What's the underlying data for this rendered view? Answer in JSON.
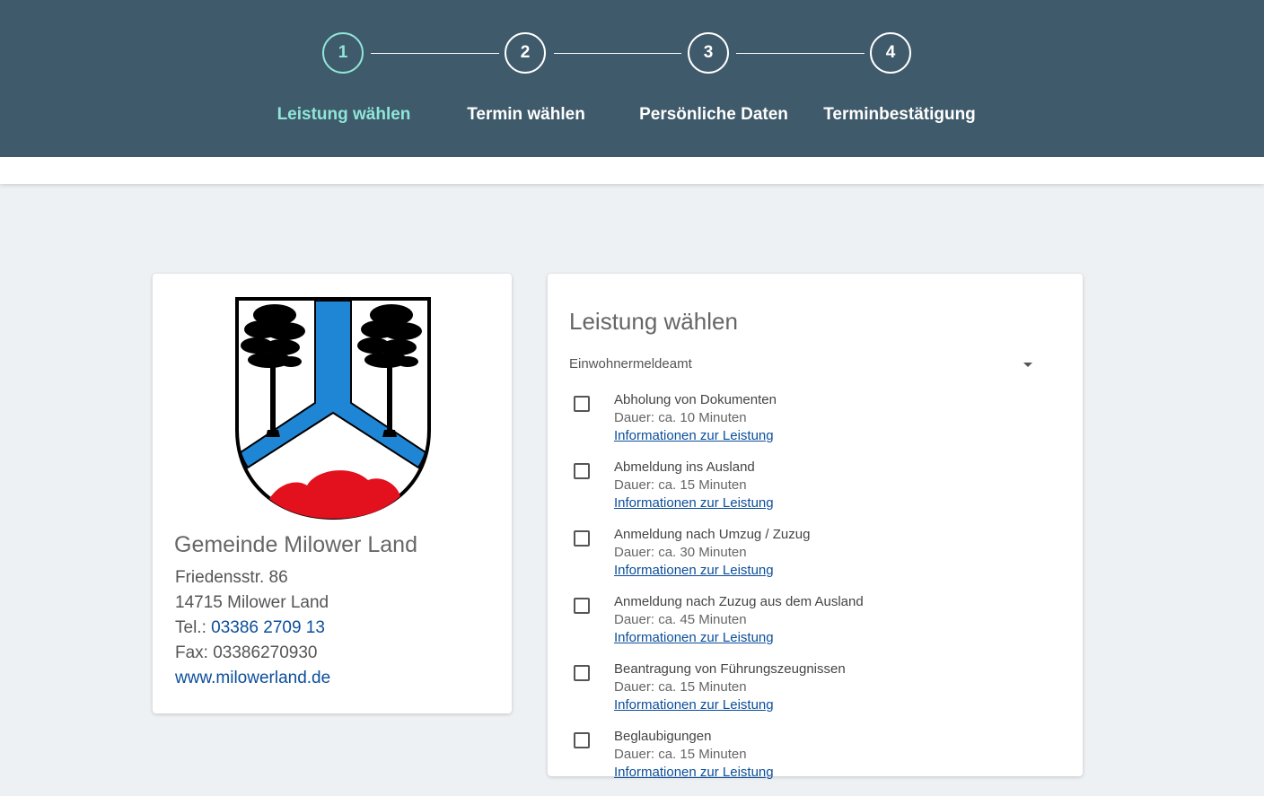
{
  "stepper": {
    "steps": [
      {
        "number": "1",
        "label": "Leistung wählen",
        "active": true
      },
      {
        "number": "2",
        "label": "Termin wählen",
        "active": false
      },
      {
        "number": "3",
        "label": "Persönliche Daten",
        "active": false
      },
      {
        "number": "4",
        "label": "Terminbestätigung",
        "active": false
      }
    ]
  },
  "office": {
    "name": "Gemeinde Milower Land",
    "street": "Friedensstr. 86",
    "city": "14715 Milower Land",
    "tel_label": "Tel.:",
    "tel": "03386 2709 13",
    "fax": "Fax: 03386270930",
    "website": "www.milowerland.de"
  },
  "services": {
    "title": "Leistung wählen",
    "dropdown_value": "Einwohnermeldeamt",
    "items": [
      {
        "name": "Abholung von Dokumenten",
        "duration": "Dauer: ca. 10 Minuten",
        "info": "Informationen zur Leistung"
      },
      {
        "name": "Abmeldung ins Ausland",
        "duration": "Dauer: ca. 15 Minuten",
        "info": "Informationen zur Leistung"
      },
      {
        "name": "Anmeldung nach Umzug / Zuzug",
        "duration": "Dauer: ca. 30 Minuten",
        "info": "Informationen zur Leistung"
      },
      {
        "name": "Anmeldung nach Zuzug aus dem Ausland",
        "duration": "Dauer: ca. 45 Minuten",
        "info": "Informationen zur Leistung"
      },
      {
        "name": "Beantragung von Führungszeugnissen",
        "duration": "Dauer: ca. 15 Minuten",
        "info": "Informationen zur Leistung"
      },
      {
        "name": "Beglaubigungen",
        "duration": "Dauer: ca. 15 Minuten",
        "info": "Informationen zur Leistung"
      }
    ]
  },
  "colors": {
    "header_bg": "#3f5a6b",
    "active_step": "#8fe6d8",
    "link": "#0b4e9a",
    "crest_blue": "#1f86d6",
    "crest_red": "#e3101e"
  }
}
